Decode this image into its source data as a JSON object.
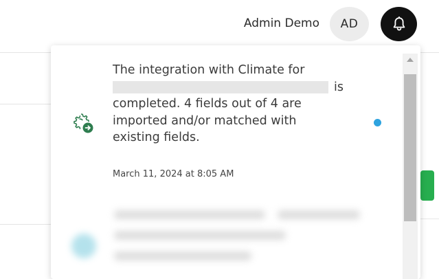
{
  "header": {
    "user_name": "Admin Demo",
    "avatar_initials": "AD",
    "notifications_icon": "bell-icon"
  },
  "notifications": [
    {
      "icon": "integration-gear-icon",
      "text_line_1": "The integration with Climate for",
      "text_line_2_tail": "is",
      "text_line_3": "completed. 4 fields out of 4 are",
      "text_line_4": "imported and/or matched with",
      "text_line_5": "existing fields.",
      "date": "March 11, 2024 at 8:05 AM",
      "unread": true
    }
  ],
  "colors": {
    "unread_dot": "#2ea3df",
    "icon_green": "#2e7d4f",
    "bell_button": "#111111",
    "action_green": "#27ae4f"
  }
}
